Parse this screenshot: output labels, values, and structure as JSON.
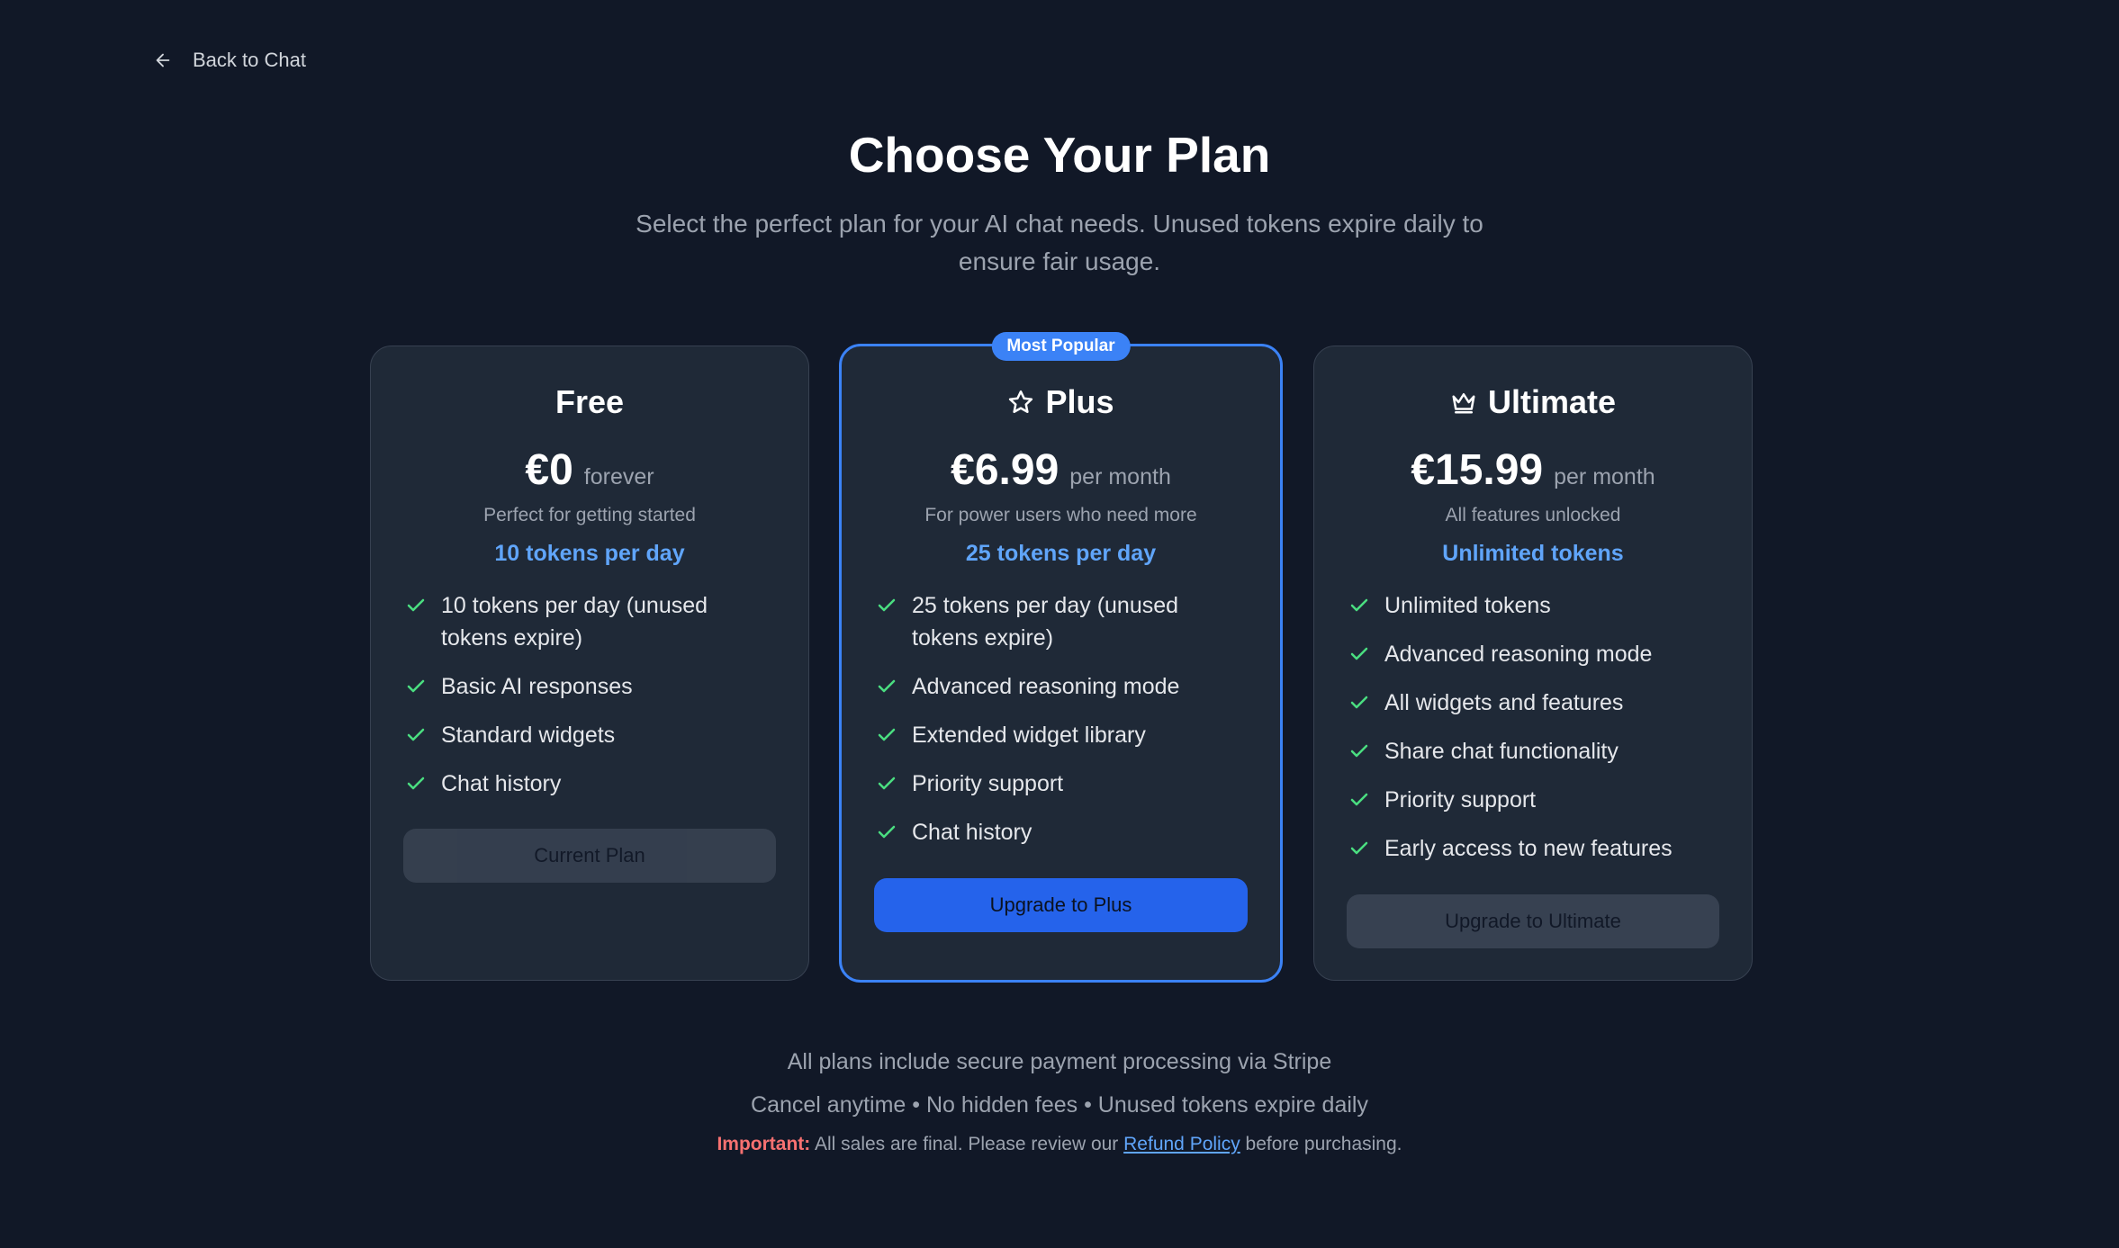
{
  "nav": {
    "back_label": "Back to Chat"
  },
  "header": {
    "title": "Choose Your Plan",
    "subtitle": "Select the perfect plan for your AI chat needs. Unused tokens expire daily to ensure fair usage."
  },
  "plans": [
    {
      "name": "Free",
      "icon": "none",
      "price": "€0",
      "period": "forever",
      "tagline": "Perfect for getting started",
      "tokens": "10 tokens per day",
      "features": [
        "10 tokens per day (unused tokens expire)",
        "Basic AI responses",
        "Standard widgets",
        "Chat history"
      ],
      "button": "Current Plan"
    },
    {
      "name": "Plus",
      "icon": "star-icon",
      "badge": "Most Popular",
      "price": "€6.99",
      "period": "per month",
      "tagline": "For power users who need more",
      "tokens": "25 tokens per day",
      "features": [
        "25 tokens per day (unused tokens expire)",
        "Advanced reasoning mode",
        "Extended widget library",
        "Priority support",
        "Chat history"
      ],
      "button": "Upgrade to Plus"
    },
    {
      "name": "Ultimate",
      "icon": "crown-icon",
      "price": "€15.99",
      "period": "per month",
      "tagline": "All features unlocked",
      "tokens": "Unlimited tokens",
      "features": [
        "Unlimited tokens",
        "Advanced reasoning mode",
        "All widgets and features",
        "Share chat functionality",
        "Priority support",
        "Early access to new features"
      ],
      "button": "Upgrade to Ultimate"
    }
  ],
  "footer": {
    "line1": "All plans include secure payment processing via Stripe",
    "line2": "Cancel anytime • No hidden fees • Unused tokens expire daily",
    "important_label": "Important:",
    "note_before": " All sales are final. Please review our ",
    "refund_link": "Refund Policy",
    "note_after": " before purchasing."
  },
  "colors": {
    "background": "#111827",
    "card": "#1f2937",
    "accent": "#3b82f6",
    "check": "#4ade80",
    "important": "#f87171"
  }
}
